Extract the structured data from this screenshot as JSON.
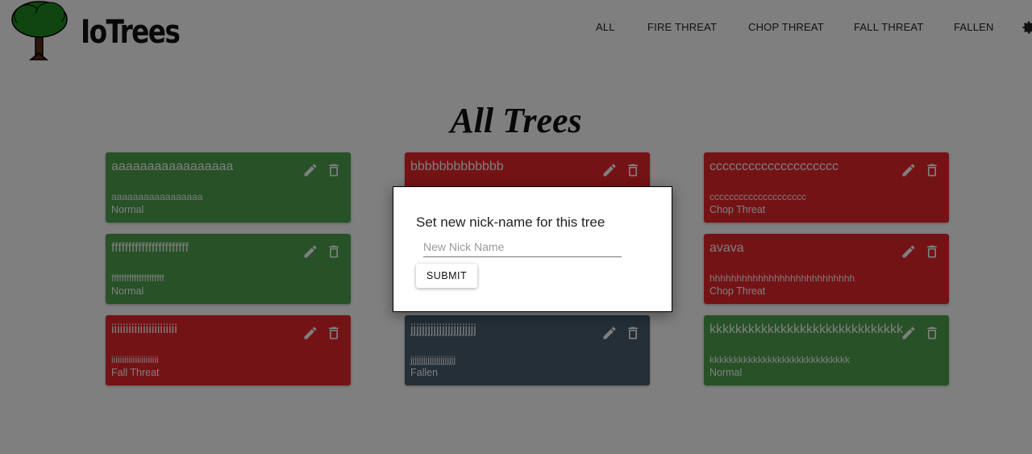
{
  "header": {
    "brand": "IoTrees",
    "nav": [
      "ALL",
      "FIRE THREAT",
      "CHOP THREAT",
      "FALL THREAT",
      "FALLEN"
    ]
  },
  "page_title": "All Trees",
  "cards": [
    {
      "name": "aaaaaaaaaaaaaaaaa",
      "id_text": "aaaaaaaaaaaaaaaaa",
      "status": "Normal",
      "kind": "normal"
    },
    {
      "name": "bbbbbbbbbbbbb",
      "id_text": "",
      "status": "",
      "kind": "threat"
    },
    {
      "name": "cccccccccccccccccccc",
      "id_text": "cccccccccccccccccccc",
      "status": "Chop Threat",
      "kind": "threat"
    },
    {
      "name": "fffffffffffffffffffffff",
      "id_text": "fffffffffffffffffffff",
      "status": "Normal",
      "kind": "normal"
    },
    {
      "name": "",
      "id_text": "",
      "status": "",
      "kind": "hidden"
    },
    {
      "name": "avava",
      "id_text": "hhhhhhhhhhhhhhhhhhhhhhhhhhh",
      "status": "Chop Threat",
      "kind": "threat"
    },
    {
      "name": "iiiiiiiiiiiiiiiiiiiiiii",
      "id_text": "iiiiiiiiiiiiiiiiiiiiii",
      "status": "Fall Threat",
      "kind": "threat"
    },
    {
      "name": "jjjjjjjjjjjjjjjjjjjjjjj",
      "id_text": "jjjjjjjjjjjjjjjjjjjjj",
      "status": "Fallen",
      "kind": "fallen"
    },
    {
      "name": "kkkkkkkkkkkkkkkkkkkkkkkkkkkkkk",
      "id_text": "kkkkkkkkkkkkkkkkkkkkkkkkkkkkk",
      "status": "Normal",
      "kind": "normal"
    }
  ],
  "dialog": {
    "title": "Set new nick-name for this tree",
    "input_placeholder": "New Nick Name",
    "input_value": "",
    "submit_label": "SUBMIT"
  },
  "colors": {
    "normal": "#4ea34e",
    "threat": "#e8262a",
    "fallen": "#495f70"
  },
  "icons": [
    "tree-logo",
    "gear-icon",
    "edit-icon",
    "delete-icon"
  ]
}
